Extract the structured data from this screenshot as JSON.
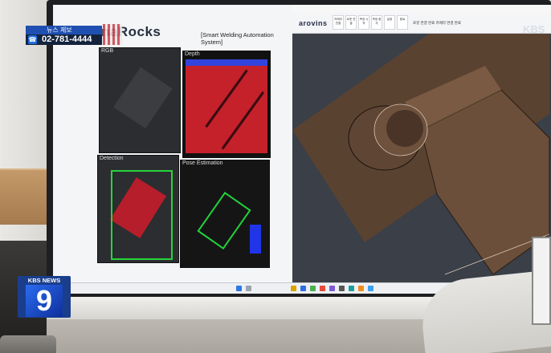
{
  "overlay": {
    "news_tip_label": "뉴스 제보",
    "news_tip_phone": "02-781-4444",
    "broadcaster_logo_top": "KBS NEWS",
    "broadcaster_logo_number": "9",
    "corner_watermark": "KBS"
  },
  "left_app": {
    "logo": "naRocks",
    "title": "[Smart Welding Automation System]",
    "panels": {
      "rgb": "RGB",
      "depth": "Depth",
      "detection": "Detection",
      "pose": "Pose Estimation"
    }
  },
  "right_app": {
    "brand": "arovins",
    "toolbar_buttons": [
      "카메라 연결",
      "로봇 연결",
      "측정 시작",
      "측정 중지",
      "설정",
      "종료"
    ],
    "status_text": "로봇 연결 완료 카메라 연결 완료"
  },
  "colors": {
    "depth_red": "#c4212b",
    "detection_green": "#27d43a",
    "object_brown": "#6b4f3a",
    "viewport_bg": "#3a3f48",
    "kbs_blue": "#1a3e8c"
  }
}
